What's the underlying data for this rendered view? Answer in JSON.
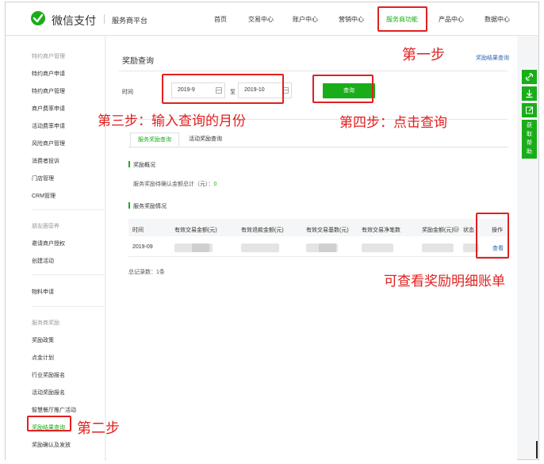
{
  "header": {
    "brand": "微信支付",
    "platform": "服务商平台",
    "nav": [
      "首页",
      "交易中心",
      "账户中心",
      "营销中心",
      "服务商功能",
      "产品中心",
      "数据中心"
    ],
    "active_nav": "服务商功能"
  },
  "sidebar": {
    "group1": "特约商户管理",
    "items1": [
      "特约商户申请",
      "特约商户管理",
      "商户费率申请",
      "活动费率申请",
      "风险商户管理",
      "消费者投诉",
      "门店管理",
      "CRM管理"
    ],
    "group2": "朋友圈营养",
    "items2": [
      "邀请商户授权",
      "创建活动"
    ],
    "items3": [
      "物料申请"
    ],
    "group4": "服务商奖励",
    "items4": [
      "奖励政策",
      "点金计划",
      "行业奖励报名",
      "活动奖励报名",
      "智慧餐厅推广活动",
      "奖励结果查询",
      "奖励确认及发放"
    ],
    "active_item": "奖励结果查询"
  },
  "main": {
    "title": "奖励查询",
    "result_link": "奖励结果查询",
    "time_label": "时间",
    "date_from": "2019-9",
    "to_label": "至",
    "date_to": "2019-10",
    "query_button": "查询",
    "tabs": [
      "服务奖励查询",
      "活动奖励查询"
    ],
    "overview_title": "奖励概况",
    "summary_label": "服务奖励待确认金额总计（元）：",
    "summary_value": "0",
    "details_title": "服务奖励情况",
    "table": {
      "headers": [
        "时间",
        "有效交易金额(元)",
        "有效退款金额(元)",
        "有效交易基数(元)",
        "有效交易净笔数",
        "奖励金额(元)",
        "状态",
        "操作"
      ],
      "rows": [
        {
          "time": "2019-09",
          "action": "查看"
        }
      ]
    },
    "total_label": "总记录数：1条"
  },
  "float_bar": {
    "icons": [
      "link-icon",
      "download-icon",
      "edit-icon"
    ],
    "help_text": "获取帮助"
  },
  "annotations": {
    "step1": "第一步",
    "step2": "第二步",
    "step3": "第三步：输入查询的月份",
    "step4": "第四步：点击查询",
    "detail_note": "可查看奖励明细账单",
    "color": "#e02020"
  },
  "colors": {
    "accent": "#1aad19",
    "link": "#2a6ab5",
    "annotation": "#e02020"
  }
}
